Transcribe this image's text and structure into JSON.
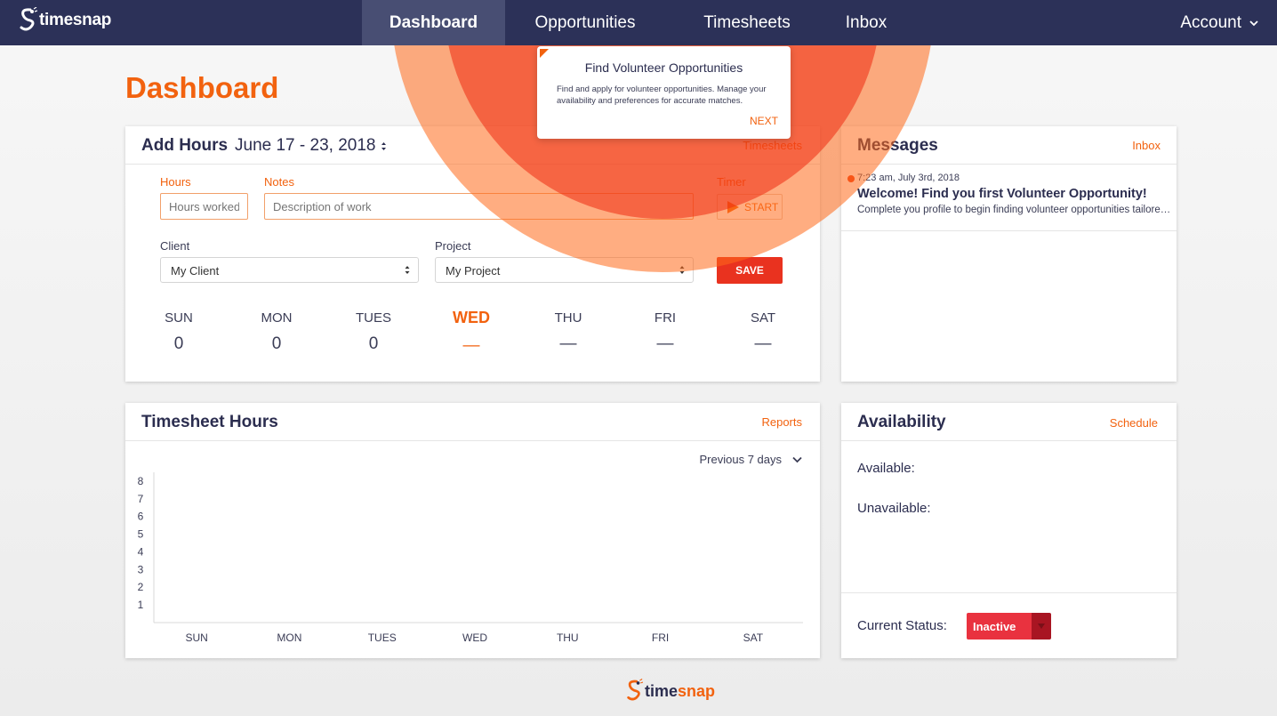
{
  "nav": {
    "brand": "timesnap",
    "tabs": [
      {
        "label": "Dashboard",
        "active": true
      },
      {
        "label": "Opportunities",
        "active": false
      },
      {
        "label": "Timesheets",
        "active": false
      },
      {
        "label": "Inbox",
        "active": false
      }
    ],
    "account_label": "Account",
    "account_icon": "chevron-down-icon"
  },
  "page_title": "Dashboard",
  "tooltip": {
    "title": "Find Volunteer Opportunities",
    "body": "Find and apply for volunteer opportunities. Manage your availability and preferences for accurate matches.",
    "next_label": "NEXT"
  },
  "add_hours": {
    "title": "Add Hours",
    "week_range": "June 17 - 23, 2018",
    "link": "Timesheets",
    "hours_label": "Hours",
    "hours_placeholder": "Hours worked",
    "notes_label": "Notes",
    "notes_placeholder": "Description of work",
    "timer_label": "Timer",
    "start_label": "START",
    "client_label": "Client",
    "client_value": "My Client",
    "project_label": "Project",
    "project_value": "My Project",
    "save_label": "SAVE",
    "days": [
      {
        "name": "SUN",
        "value": "0",
        "today": false
      },
      {
        "name": "MON",
        "value": "0",
        "today": false
      },
      {
        "name": "TUES",
        "value": "0",
        "today": false
      },
      {
        "name": "WED",
        "value": "—",
        "today": true
      },
      {
        "name": "THU",
        "value": "—",
        "today": false
      },
      {
        "name": "FRI",
        "value": "—",
        "today": false
      },
      {
        "name": "SAT",
        "value": "—",
        "today": false
      }
    ]
  },
  "messages": {
    "title": "Messages",
    "link": "Inbox",
    "items": [
      {
        "time": "7:23 am, July 3rd, 2018",
        "subject": "Welcome! Find you first Volunteer Opportunity!",
        "preview": "Complete you profile to begin finding volunteer opportunities tailored to your skills and interests."
      }
    ]
  },
  "timesheet_hours": {
    "title": "Timesheet Hours",
    "link": "Reports",
    "range_label": "Previous 7 days"
  },
  "chart_data": {
    "type": "bar",
    "categories": [
      "SUN",
      "MON",
      "TUES",
      "WED",
      "THU",
      "FRI",
      "SAT"
    ],
    "values": [
      0,
      0,
      0,
      0,
      0,
      0,
      0
    ],
    "yticks": [
      "1",
      "2",
      "3",
      "4",
      "5",
      "6",
      "7",
      "8"
    ],
    "ylim": [
      0,
      8.5
    ],
    "title": "",
    "xlabel": "",
    "ylabel": ""
  },
  "availability": {
    "title": "Availability",
    "link": "Schedule",
    "available_label": "Available:",
    "unavailable_label": "Unavailable:",
    "status_label": "Current Status:",
    "status_value": "Inactive",
    "colors": {
      "status": "#e9323f",
      "status_dark": "#a81522"
    }
  },
  "footer": {
    "brand_a": "time",
    "brand_b": "snap"
  },
  "colors": {
    "accent": "#f2620f",
    "nav": "#2c3158",
    "nav_active": "#484e73",
    "danger": "#e9321f"
  }
}
